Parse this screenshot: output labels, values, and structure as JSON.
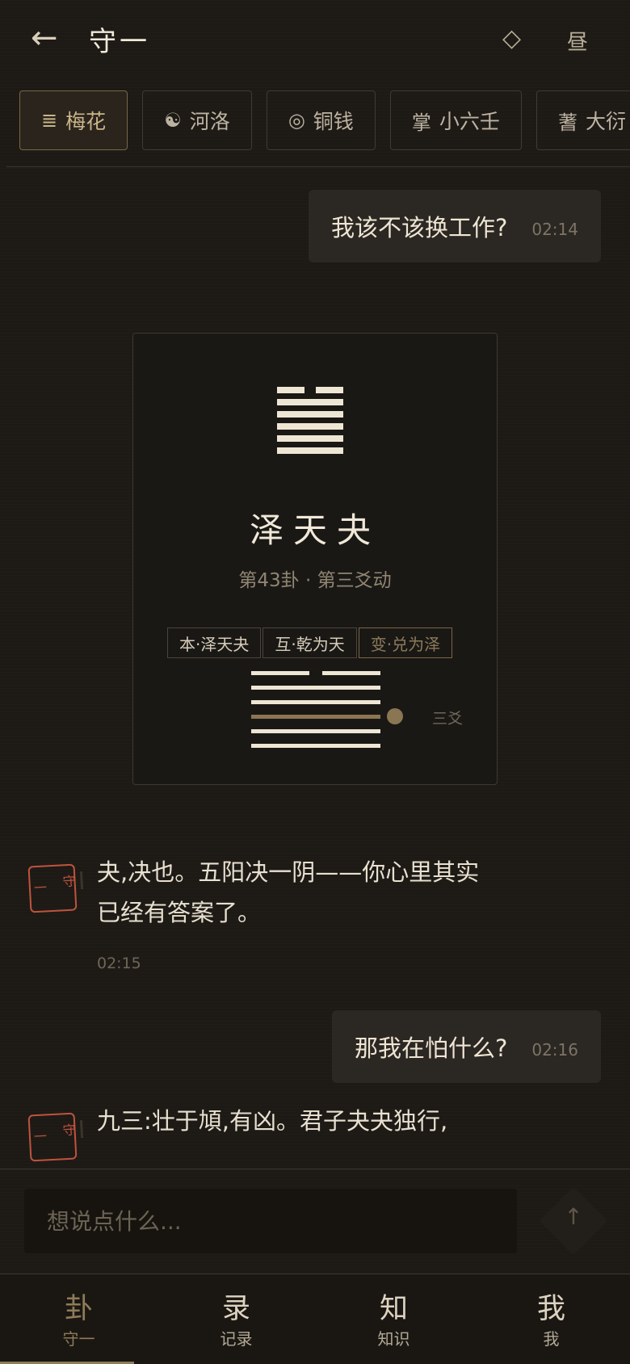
{
  "header": {
    "back_icon": "←",
    "title": "守一",
    "diamond_icon": "◇",
    "day_label": "昼"
  },
  "method_tabs": [
    {
      "icon": "𝌆",
      "label": "梅花",
      "active": true
    },
    {
      "icon": "☯",
      "label": "河洛",
      "active": false
    },
    {
      "icon": "◎",
      "label": "铜钱",
      "active": false
    },
    {
      "icon": "掌",
      "label": "小六壬",
      "active": false
    },
    {
      "icon": "蓍",
      "label": "大衍",
      "active": false
    }
  ],
  "messages": {
    "user1": {
      "text": "我该不该换工作?",
      "time": "02:14"
    },
    "card": {
      "gua_name": "泽天夬",
      "subtitle": "第43卦 · 第三爻动",
      "tabs": [
        "本·泽天夬",
        "互·乾为天",
        "变·兑为泽"
      ],
      "selected_tab": 2,
      "yao_label": "三爻"
    },
    "bot1": {
      "seal_a": "一",
      "seal_b": "守",
      "line1": "夬,决也。五阳决一阴——你心里其实",
      "line2": "已经有答案了。",
      "time": "02:15"
    },
    "user2": {
      "text": "那我在怕什么?",
      "time": "02:16"
    },
    "bot2": {
      "seal_a": "一",
      "seal_b": "守",
      "line1": "九三:壮于頄,有凶。君子夬夬独行,"
    }
  },
  "input": {
    "placeholder": "想说点什么...",
    "send_icon": "↑"
  },
  "nav": [
    {
      "big": "卦",
      "small": "守一",
      "active": true
    },
    {
      "big": "录",
      "small": "记录",
      "active": false
    },
    {
      "big": "知",
      "small": "知识",
      "active": false
    },
    {
      "big": "我",
      "small": "我",
      "active": false
    }
  ],
  "colors": {
    "background": "#1d1a16",
    "accent": "#8f7b57",
    "seal": "#c0533d"
  }
}
